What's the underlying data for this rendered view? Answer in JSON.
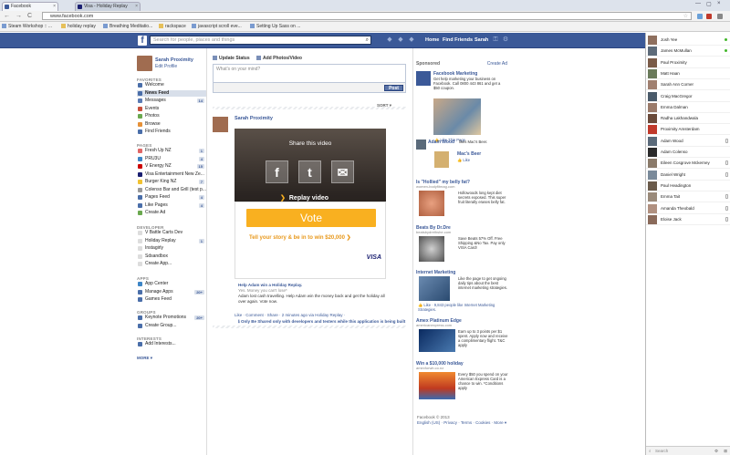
{
  "browser": {
    "tabs": [
      {
        "label": "Facebook",
        "close": "×"
      },
      {
        "label": "Visa - Holiday Replay",
        "close": "×"
      }
    ],
    "window_controls": [
      "—",
      "▢",
      "×"
    ],
    "nav": {
      "back": "←",
      "forward": "→",
      "reload": "C"
    },
    "url": "www.facebook.com",
    "star": "☆",
    "bookmarks": [
      {
        "label": "Steam Workshop :: ...",
        "icon": "page-icon"
      },
      {
        "label": "holiday replay",
        "icon": "folder-icon"
      },
      {
        "label": "Breathing Meditatio...",
        "icon": "page-icon"
      },
      {
        "label": "rackspace",
        "icon": "folder-icon"
      },
      {
        "label": "javascript scroll eve...",
        "icon": "page-icon"
      },
      {
        "label": "Setting Up Sass on ...",
        "icon": "page-icon"
      }
    ]
  },
  "fb_header": {
    "logo": "f",
    "search_placeholder": "Search for people, places and things",
    "search_icon": "⌕",
    "links": [
      "Home",
      "Find Friends",
      "Sarah"
    ],
    "icons": [
      "friend-requests-icon",
      "messages-icon",
      "notifications-icon",
      "lock-icon",
      "settings-icon"
    ]
  },
  "profile": {
    "name": "Sarah Proximity",
    "edit": "Edit Profile"
  },
  "left_nav": {
    "favorites_title": "FAVORITES",
    "favorites": [
      {
        "label": "Welcome",
        "count": "",
        "color": "#4a6ea9"
      },
      {
        "label": "News Feed",
        "count": "",
        "color": "#4a6ea9",
        "active": true
      },
      {
        "label": "Messages",
        "count": "14",
        "color": "#5b7bb4"
      },
      {
        "label": "Events",
        "count": "",
        "color": "#c8503c"
      },
      {
        "label": "Photos",
        "count": "",
        "color": "#6aa84f"
      },
      {
        "label": "Browse",
        "count": "",
        "color": "#e69138"
      },
      {
        "label": "Find Friends",
        "count": "",
        "color": "#4a6ea9"
      }
    ],
    "pages_title": "PAGES",
    "pages": [
      {
        "label": "Fresh Up NZ",
        "count": "1",
        "color": "#e06666"
      },
      {
        "label": "PRU3U",
        "count": "4",
        "color": "#3d85c6"
      },
      {
        "label": "V Energy NZ",
        "count": "15",
        "color": "#cc0000"
      },
      {
        "label": "Visa Entertainment New Ze...",
        "count": "",
        "color": "#1a1f71"
      },
      {
        "label": "Burger King NZ",
        "count": "7",
        "color": "#f1c232"
      },
      {
        "label": "Colenso Bar and Grill (test p...",
        "count": "",
        "color": "#999999"
      },
      {
        "label": "Pages Feed",
        "count": "4",
        "color": "#4a6ea9"
      },
      {
        "label": "Like Pages",
        "count": "4",
        "color": "#4a6ea9"
      },
      {
        "label": "Create Ad",
        "count": "",
        "color": "#6aa84f"
      }
    ],
    "developer_title": "DEVELOPER",
    "developer": [
      {
        "label": "V Battle Carts Dev",
        "count": "",
        "color": "#dddddd"
      },
      {
        "label": "Holiday Replay",
        "count": "1",
        "color": "#dddddd"
      },
      {
        "label": "Instagirly",
        "count": "",
        "color": "#dddddd"
      },
      {
        "label": "Sdsandbox",
        "count": "",
        "color": "#dddddd"
      },
      {
        "label": "Create App...",
        "count": "",
        "color": "#dddddd"
      }
    ],
    "apps_title": "APPS",
    "apps": [
      {
        "label": "App Center",
        "count": "",
        "color": "#3d85c6"
      },
      {
        "label": "Manage Apps",
        "count": "20+",
        "color": "#4a6ea9"
      },
      {
        "label": "Games Feed",
        "count": "",
        "color": "#4a6ea9"
      }
    ],
    "groups_title": "GROUPS",
    "groups": [
      {
        "label": "Keynote Promotions",
        "count": "20+",
        "color": "#4a6ea9"
      },
      {
        "label": "Create Group...",
        "count": "",
        "color": "#4a6ea9"
      }
    ],
    "interests_title": "INTERESTS",
    "interests": [
      {
        "label": "Add Interests...",
        "count": "",
        "color": "#4a6ea9"
      }
    ],
    "more": "MORE ▾"
  },
  "composer": {
    "update_status": "Update Status",
    "add_photos": "Add Photos/Video",
    "placeholder": "What's on your mind?",
    "post": "Post",
    "sort": "SORT ▾"
  },
  "story": {
    "author": "Sarah Proximity",
    "share_title": "Share this video",
    "share_buttons": [
      "f",
      "t",
      "✉"
    ],
    "replay": "Replay video",
    "vote": "Vote",
    "tell": "Tell your story & be in to win $20,000",
    "visa": "VISA",
    "video_title": "Help Adam win a Holiday Replay.",
    "video_sub": "Yes. Money you can't lose*",
    "video_desc": "Adam lost cash travelling. Help Adam win the money back and get the holiday all over again. Vote now.",
    "actions": "Like · Comment · Share · 2 minutes ago via Holiday Replay ·",
    "note": "Only Be Shared only with developers and testers while this application is being built"
  },
  "sponsored": {
    "title": "Sponsored",
    "create_ad": "Create Ad",
    "ads": [
      {
        "title": "Facebook Marketing",
        "url": "",
        "text": "Get help marketing your business on Facebook. Call 0800 443 861 and get a $50 coupon.",
        "like": "Like This Page"
      },
      {
        "title": "Adam Wood",
        "url": "",
        "text": "likes Mac's Beer.",
        "like": ""
      },
      {
        "title": "Mac's Beer",
        "url": "",
        "text": "",
        "like": "Like"
      },
      {
        "title": "Is \"Hollied\" my belly fat?",
        "url": "women-bodyfitmag.com",
        "text": "Hollowoods long kept diet secrets exposed. This super fruit literally erases belly fat.",
        "like": ""
      },
      {
        "title": "Beats By Dr.Dre",
        "url": "beatsbydrethshe.com",
        "text": "Save Beats 57% Off. Free Shipping &No Tax. Pay only VISA Card!",
        "like": ""
      },
      {
        "title": "Internet Marketing",
        "url": "",
        "text": "Like the page to get ongoing daily tips about the best internet marketing strategies.",
        "like": "Like · 9,843 people like Internet Marketing Strategies."
      },
      {
        "title": "Amex Platinum Edge",
        "url": "americanexpress.com",
        "text": "Earn up to 3 points per $1 spent. Apply now and receive a complimentary flight. T&C apply",
        "like": ""
      },
      {
        "title": "Win a $10,000 holiday",
        "url": "amexforwb.co.nz",
        "text": "Every $50 you spend on your American Express Card is a chance to win. *Conditions apply",
        "like": ""
      }
    ]
  },
  "footer": {
    "copyright": "Facebook © 2013",
    "links": "English (US) · Privacy · Terms · Cookies · More ▾"
  },
  "chat": {
    "contacts": [
      {
        "name": "Josh Yee",
        "status": "online",
        "color": "#8e6f5e"
      },
      {
        "name": "James McMullan",
        "status": "online",
        "color": "#5d6b7a"
      },
      {
        "name": "Paul Proximity",
        "status": "",
        "color": "#7a5b48"
      },
      {
        "name": "Matt Haan",
        "status": "",
        "color": "#6a7a5a"
      },
      {
        "name": "Sarah Ann Corner",
        "status": "",
        "color": "#a08070"
      },
      {
        "name": "Craig MacGregor",
        "status": "",
        "color": "#4a5a6a"
      },
      {
        "name": "Emma Dalman",
        "status": "",
        "color": "#9a7a6a"
      },
      {
        "name": "Radha Lakhandwala",
        "status": "",
        "color": "#6a4a3a"
      },
      {
        "name": "Proximity Amsterdam",
        "status": "",
        "color": "#c0392b"
      },
      {
        "name": "Adam Wood",
        "status": "mobile",
        "color": "#5a6a7a"
      },
      {
        "name": "Adam Colenso",
        "status": "",
        "color": "#2a2a2a"
      },
      {
        "name": "Eileen Cosgrove Mckerney",
        "status": "mobile",
        "color": "#8a7a6a"
      },
      {
        "name": "Daniel Wright",
        "status": "mobile",
        "color": "#7a8a9a"
      },
      {
        "name": "Paul Headington",
        "status": "",
        "color": "#6a5a4a"
      },
      {
        "name": "Emma Tait",
        "status": "mobile",
        "color": "#9a8a7a"
      },
      {
        "name": "Amanda Theobald",
        "status": "mobile",
        "color": "#b09080"
      },
      {
        "name": "Eloise Jack",
        "status": "mobile",
        "color": "#8a6a5a"
      }
    ],
    "search": "Search",
    "search_icon": "⌕",
    "gear": "⚙",
    "close": "⊠"
  }
}
